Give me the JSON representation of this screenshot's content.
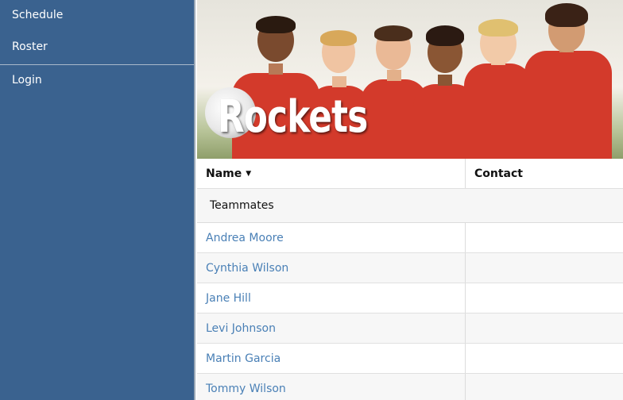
{
  "sidebar": {
    "items": [
      {
        "label": "Schedule"
      },
      {
        "label": "Roster"
      },
      {
        "label": "Login"
      }
    ]
  },
  "banner": {
    "title": "Rockets"
  },
  "table": {
    "columns": [
      {
        "label": "Name",
        "sort_icon": "caret-down"
      },
      {
        "label": "Contact"
      }
    ],
    "group_label": "Teammates",
    "rows": [
      {
        "name": "Andrea Moore",
        "contact": ""
      },
      {
        "name": "Cynthia Wilson",
        "contact": ""
      },
      {
        "name": "Jane Hill",
        "contact": ""
      },
      {
        "name": "Levi Johnson",
        "contact": ""
      },
      {
        "name": "Martin Garcia",
        "contact": ""
      },
      {
        "name": "Tommy Wilson",
        "contact": ""
      }
    ]
  },
  "colors": {
    "sidebar_bg": "#3a628f",
    "link": "#4a80b6",
    "jersey": "#d33a2b"
  }
}
